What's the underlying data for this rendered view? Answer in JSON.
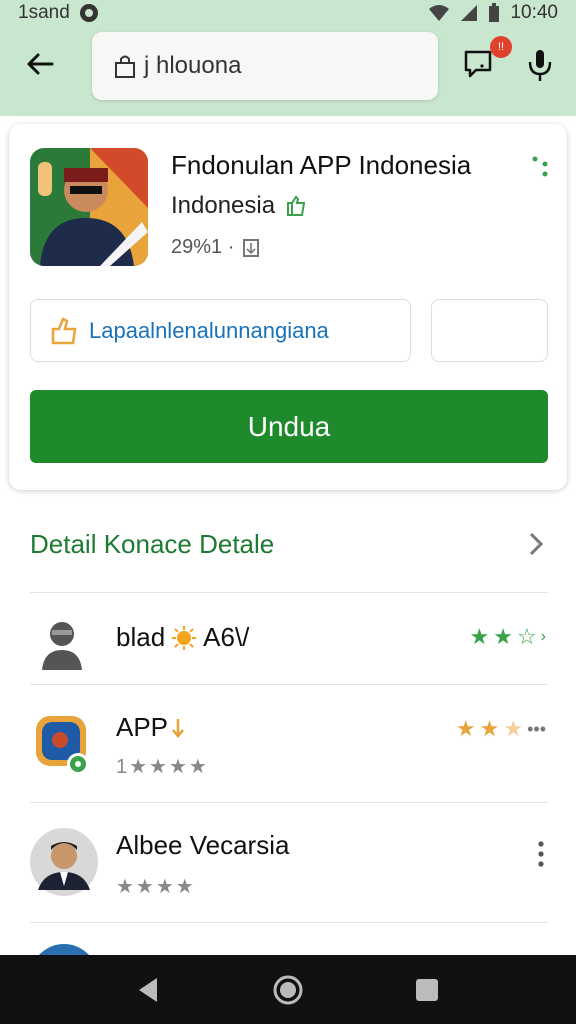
{
  "status_bar": {
    "carrier": "1sand",
    "time": "10:40"
  },
  "search": {
    "value": "j hlouona",
    "badge_count": "!!"
  },
  "app": {
    "title": "Fndonulan APP Indonesia",
    "subtitle": "Indonesia",
    "meta": "29%1 ·",
    "promo_text": "Lapaalnlenalunnangiana",
    "install_label": "Undua"
  },
  "details": {
    "title": "Detail Konace Detale"
  },
  "list": [
    {
      "title": "blad",
      "title_suffix": "A6\\/",
      "subtitle": ""
    },
    {
      "title": "APP",
      "title_suffix": "",
      "subtitle": "1★★★★"
    },
    {
      "title": "Albee Vecarsia",
      "title_suffix": "",
      "subtitle": "★★★★"
    }
  ],
  "colors": {
    "accent_green": "#1e8a2c",
    "header_bg": "#c9e6cf",
    "detail_green": "#1e7a32"
  }
}
